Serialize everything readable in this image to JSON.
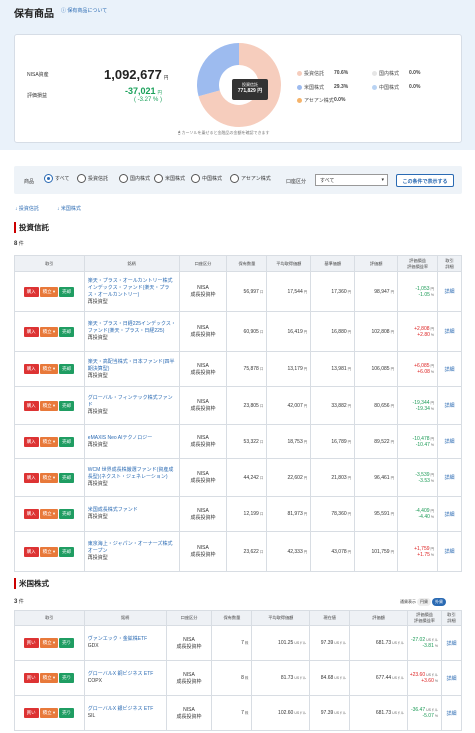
{
  "page": {
    "title": "保有商品",
    "about_link": "保有商品について"
  },
  "summary": {
    "nisa_label": "NISA資産",
    "nisa_value": "1,092,677",
    "nisa_unit": "円",
    "gl_label": "評価損益",
    "gl_value": "-37,021",
    "gl_unit": "円",
    "gl_pct": "( -3.27 % )",
    "tooltip_label": "投資信託",
    "tooltip_value": "771,829 円",
    "note": "カーソルを乗せると金融品の金額を確認できます",
    "allocation": [
      {
        "name": "投資信託",
        "pct": "70.6%",
        "value": 70.6,
        "color": "#f6cdbd"
      },
      {
        "name": "国内株式",
        "pct": "0.0%",
        "value": 0,
        "color": "#e6e6e6"
      },
      {
        "name": "米国株式",
        "pct": "29.3%",
        "value": 29.3,
        "color": "#9dbbef"
      },
      {
        "name": "中国株式",
        "pct": "0.0%",
        "value": 0,
        "color": "#b9d3f3"
      },
      {
        "name": "アセアン株式",
        "pct": "0.0%",
        "value": 0,
        "color": "#f5b36a"
      }
    ]
  },
  "filter": {
    "product_label": "商品",
    "options": [
      "すべて",
      "投資信託",
      "国内株式",
      "米国株式",
      "中国株式",
      "アセアン株式"
    ],
    "selected": "すべて",
    "account_label": "口座区分",
    "account_value": "すべて",
    "show_button": "この条件で表示する"
  },
  "jump_links": [
    "投資信託",
    "米国株式"
  ],
  "funds": {
    "title": "投資信託",
    "count": "8",
    "count_unit": "件",
    "headers": [
      "取引",
      "銘柄",
      "口座区分",
      "保有数量",
      "平均取得価額",
      "基準価額",
      "評価額",
      "評価損益\n評価損益率",
      "取引\n詳細"
    ],
    "buttons": [
      "購入",
      "積立",
      "売却"
    ],
    "detail": "詳細",
    "rows": [
      {
        "name": "楽天・プラス・オールカントリー株式インデックス・ファンド(楽天・プラス・オールカントリー)",
        "type": "再投資型",
        "acct1": "NISA",
        "acct2": "成長投資枠",
        "qty": "56,997",
        "qu": "口",
        "avg": "17,544",
        "au": "円",
        "nav": "17,360",
        "nu": "円",
        "val": "98,947",
        "vu": "円",
        "gl": "-1,053",
        "glu": "円",
        "pct": "-1.05",
        "pu": "%",
        "sign": "neg"
      },
      {
        "name": "楽天・プラス・日経225インデックス・ファンド(楽天・プラス・日経225)",
        "type": "再投資型",
        "acct1": "NISA",
        "acct2": "成長投資枠",
        "qty": "60,905",
        "qu": "口",
        "avg": "16,419",
        "au": "円",
        "nav": "16,880",
        "nu": "円",
        "val": "102,808",
        "vu": "円",
        "gl": "+2,808",
        "glu": "円",
        "pct": "+2.80",
        "pu": "%",
        "sign": "pos"
      },
      {
        "name": "楽天・高配当株式・日本ファンド(四半期決算型)",
        "type": "再投資型",
        "acct1": "NISA",
        "acct2": "成長投資枠",
        "qty": "75,878",
        "qu": "口",
        "avg": "13,179",
        "au": "円",
        "nav": "13,981",
        "nu": "円",
        "val": "106,085",
        "vu": "円",
        "gl": "+6,085",
        "glu": "円",
        "pct": "+6.08",
        "pu": "%",
        "sign": "pos"
      },
      {
        "name": "グローバル・フィンテック株式ファンド",
        "type": "再投資型",
        "acct1": "NISA",
        "acct2": "成長投資枠",
        "qty": "23,805",
        "qu": "口",
        "avg": "42,007",
        "au": "円",
        "nav": "33,882",
        "nu": "円",
        "val": "80,656",
        "vu": "円",
        "gl": "-19,344",
        "glu": "円",
        "pct": "-19.34",
        "pu": "%",
        "sign": "neg"
      },
      {
        "name": "eMAXIS Neo AIテクノロジー",
        "type": "再投資型",
        "acct1": "NISA",
        "acct2": "成長投資枠",
        "qty": "53,322",
        "qu": "口",
        "avg": "18,753",
        "au": "円",
        "nav": "16,789",
        "nu": "円",
        "val": "89,522",
        "vu": "円",
        "gl": "-10,478",
        "glu": "円",
        "pct": "-10.47",
        "pu": "%",
        "sign": "neg"
      },
      {
        "name": "WCM 世界成長株厳選ファンド(資産成長型)(ネクスト・ジェネレーション)",
        "type": "再投資型",
        "acct1": "NISA",
        "acct2": "成長投資枠",
        "qty": "44,242",
        "qu": "口",
        "avg": "22,602",
        "au": "円",
        "nav": "21,803",
        "nu": "円",
        "val": "96,461",
        "vu": "円",
        "gl": "-3,539",
        "glu": "円",
        "pct": "-3.53",
        "pu": "%",
        "sign": "neg"
      },
      {
        "name": "米国成長株式ファンド",
        "type": "再投資型",
        "acct1": "NISA",
        "acct2": "成長投資枠",
        "qty": "12,199",
        "qu": "口",
        "avg": "81,973",
        "au": "円",
        "nav": "78,360",
        "nu": "円",
        "val": "95,591",
        "vu": "円",
        "gl": "-4,409",
        "glu": "円",
        "pct": "-4.40",
        "pu": "%",
        "sign": "neg"
      },
      {
        "name": "東京海上・ジャパン・オーナーズ株式オープン",
        "type": "再投資型",
        "acct1": "NISA",
        "acct2": "成長投資枠",
        "qty": "23,622",
        "qu": "口",
        "avg": "42,333",
        "au": "円",
        "nav": "43,078",
        "nu": "円",
        "val": "101,759",
        "vu": "円",
        "gl": "+1,759",
        "glu": "円",
        "pct": "+1.75",
        "pu": "%",
        "sign": "pos"
      }
    ]
  },
  "us": {
    "title": "米国株式",
    "count": "3",
    "count_unit": "件",
    "currency_label": "通貨表示",
    "currency_options": [
      "円貨",
      "外貨"
    ],
    "currency_selected": "外貨",
    "headers": [
      "取引",
      "銘柄",
      "口座区分",
      "保有数量",
      "平均取得価額",
      "現在値",
      "評価額",
      "評価損益\n評価損益率",
      "取引\n詳細"
    ],
    "buttons": [
      "買い",
      "積立",
      "売り"
    ],
    "detail": "詳細",
    "rows": [
      {
        "name": "ヴァンエック・金鉱株ETF",
        "ticker": "GDX",
        "acct1": "NISA",
        "acct2": "成長投資枠",
        "qty": "7",
        "qu": "株",
        "avg": "101.25",
        "au": "USドル",
        "price": "97.39",
        "pu2": "USドル",
        "val": "681.73",
        "vu": "USドル",
        "gl": "-27.02",
        "glu": "USドル",
        "pct": "-3.81",
        "pu": "%",
        "sign": "neg"
      },
      {
        "name": "グローバルX 銅ビジネス ETF",
        "ticker": "COPX",
        "acct1": "NISA",
        "acct2": "成長投資枠",
        "qty": "8",
        "qu": "株",
        "avg": "81.73",
        "au": "USドル",
        "price": "84.68",
        "pu2": "USドル",
        "val": "677.44",
        "vu": "USドル",
        "gl": "+23.60",
        "glu": "USドル",
        "pct": "+3.60",
        "pu": "%",
        "sign": "pos"
      },
      {
        "name": "グローバルX 銀ビジネス ETF",
        "ticker": "SIL",
        "acct1": "NISA",
        "acct2": "成長投資枠",
        "qty": "7",
        "qu": "株",
        "avg": "102.60",
        "au": "USドル",
        "price": "97.39",
        "pu2": "USドル",
        "val": "681.73",
        "vu": "USドル",
        "gl": "-36.47",
        "glu": "USドル",
        "pct": "-5.07",
        "pu": "%",
        "sign": "neg"
      }
    ]
  }
}
